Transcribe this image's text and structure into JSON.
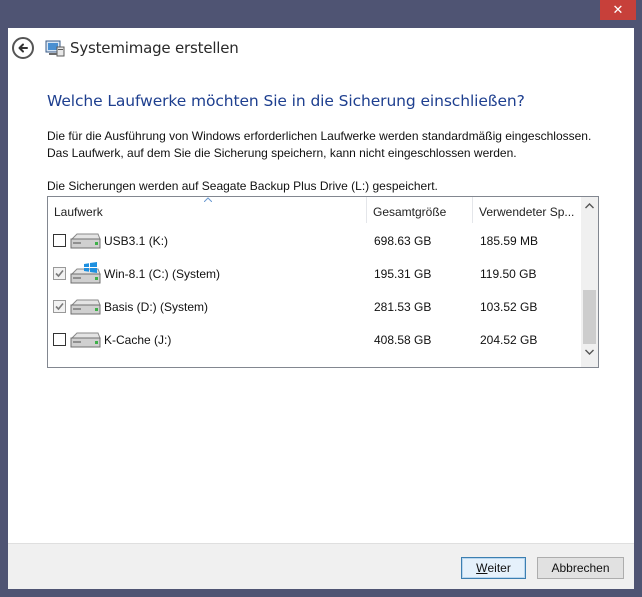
{
  "window": {
    "close_glyph": "✕",
    "title": "Systemimage erstellen",
    "back_icon": "back-arrow-icon",
    "title_icon": "system-image-icon"
  },
  "content": {
    "question": "Welche Laufwerke möchten Sie in die Sicherung einschließen?",
    "desc_line1": "Die für die Ausführung von Windows erforderlichen Laufwerke werden standardmäßig eingeschlossen.",
    "desc_line2": "Das Laufwerk, auf dem Sie die Sicherung speichern, kann nicht eingeschlossen werden.",
    "destination": "Die Sicherungen werden auf Seagate Backup Plus Drive (L:) gespeichert."
  },
  "table": {
    "columns": [
      "Laufwerk",
      "Gesamtgröße",
      "Verwendeter Sp..."
    ],
    "rows": [
      {
        "name": "USB3.1 (K:)",
        "total": "698.63 GB",
        "used": "185.59 MB",
        "checked": false,
        "icon": "drive-icon"
      },
      {
        "name": "Win-8.1 (C:) (System)",
        "total": "195.31 GB",
        "used": "119.50 GB",
        "checked": true,
        "icon": "windows-drive-icon"
      },
      {
        "name": "Basis (D:) (System)",
        "total": "281.53 GB",
        "used": "103.52 GB",
        "checked": true,
        "icon": "drive-icon"
      },
      {
        "name": "K-Cache (J:)",
        "total": "408.58 GB",
        "used": "204.52 GB",
        "checked": false,
        "icon": "drive-icon"
      }
    ]
  },
  "buttons": {
    "next_first": "W",
    "next_rest": "eiter",
    "cancel": "Abbrechen"
  },
  "colors": {
    "frame": "#4f5473",
    "close": "#c7403a",
    "heading": "#1e3f8f",
    "windows_logo": "#1e90e0"
  }
}
